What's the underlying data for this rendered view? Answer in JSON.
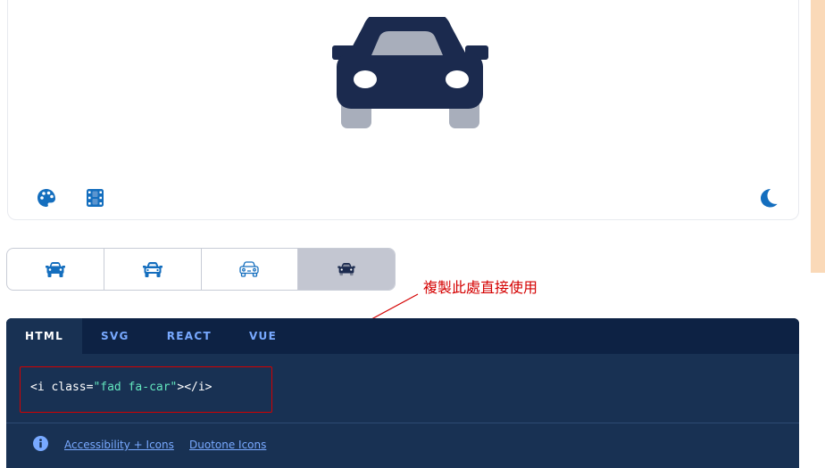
{
  "preview": {
    "main_icon": "car-icon-duotone",
    "primary_color": "#1b2a4e",
    "secondary_color": "#a8aebb",
    "tools": [
      {
        "icon": "palette-icon",
        "color": "#146ebe"
      },
      {
        "icon": "film-icon",
        "color": "#146ebe"
      },
      {
        "icon": "moon-icon",
        "color": "#146ebe"
      }
    ]
  },
  "style_switcher": {
    "options": [
      {
        "style": "solid",
        "icon": "car-icon-solid"
      },
      {
        "style": "regular",
        "icon": "car-icon-regular"
      },
      {
        "style": "light",
        "icon": "car-icon-light"
      },
      {
        "style": "duotone",
        "icon": "car-icon-duotone",
        "selected": true
      }
    ]
  },
  "annotation": {
    "text": "複製此處直接使用",
    "color": "#d40000"
  },
  "code_panel": {
    "tabs": [
      {
        "label": "HTML",
        "active": true
      },
      {
        "label": "SVG"
      },
      {
        "label": "REACT"
      },
      {
        "label": "VUE"
      }
    ],
    "snippet": {
      "before": "<i class=",
      "value": "\"fad fa-car\"",
      "after": "></i>"
    },
    "links": {
      "info_icon": "info-circle-icon",
      "accessibility": "Accessibility + Icons",
      "duotone": "Duotone Icons"
    }
  }
}
